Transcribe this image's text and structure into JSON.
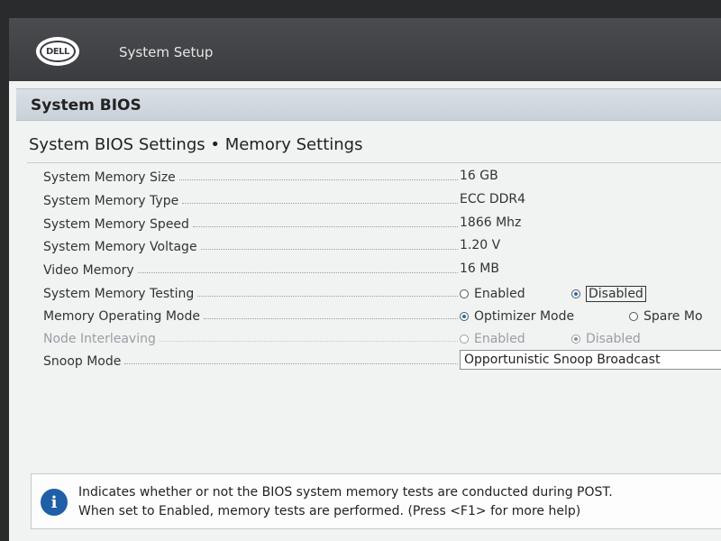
{
  "header": {
    "logo_text": "DELL",
    "app_title": "System Setup"
  },
  "section": {
    "title": "System BIOS"
  },
  "page": {
    "title": "System BIOS Settings • Memory Settings"
  },
  "settings": {
    "memory_size": {
      "label": "System Memory Size",
      "value": "16 GB"
    },
    "memory_type": {
      "label": "System Memory Type",
      "value": "ECC DDR4"
    },
    "memory_speed": {
      "label": "System Memory Speed",
      "value": "1866 Mhz"
    },
    "memory_voltage": {
      "label": "System Memory Voltage",
      "value": "1.20 V"
    },
    "video_memory": {
      "label": "Video Memory",
      "value": "16 MB"
    },
    "memory_testing": {
      "label": "System Memory Testing",
      "options": [
        "Enabled",
        "Disabled"
      ],
      "selected": "Disabled"
    },
    "operating_mode": {
      "label": "Memory Operating Mode",
      "options": [
        "Optimizer Mode",
        "Spare Mo"
      ],
      "selected": "Optimizer Mode"
    },
    "node_interleaving": {
      "label": "Node Interleaving",
      "options": [
        "Enabled",
        "Disabled"
      ],
      "selected": "Disabled",
      "disabled": true
    },
    "snoop_mode": {
      "label": "Snoop Mode",
      "value": "Opportunistic Snoop Broadcast"
    }
  },
  "help": {
    "icon": "info-icon",
    "line1": "Indicates whether or not the BIOS system memory tests are conducted during POST.",
    "line2": "When set to Enabled, memory tests are performed. (Press <F1> for more help)"
  },
  "colors": {
    "topbar": "#3b3c40",
    "section_header": "#d3dae1",
    "accent": "#1f5fa8"
  }
}
